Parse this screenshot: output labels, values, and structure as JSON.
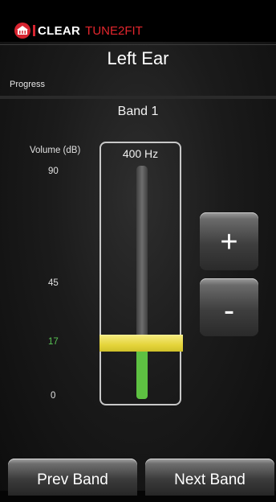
{
  "header": {
    "brand_clear": "CLEAR",
    "brand_tune": "TUNE2FIT",
    "logo_icon": "clear-logo-icon",
    "brand_color": "#e3262d"
  },
  "screen": {
    "title": "Left Ear",
    "progress_label": "Progress",
    "progress_value": 0.0,
    "band_label": "Band 1"
  },
  "slider": {
    "volume_label": "Volume (dB)",
    "frequency": "400 Hz",
    "ticks": [
      "90",
      "45",
      "17",
      "0"
    ],
    "value_db": 17,
    "min_db": 0,
    "max_db": 90,
    "fill_color": "#5ec142",
    "thumb_color": "#e4d43a"
  },
  "controls": {
    "plus_label": "+",
    "minus_label": "-",
    "prev_label": "Prev Band",
    "next_label": "Next Band"
  }
}
